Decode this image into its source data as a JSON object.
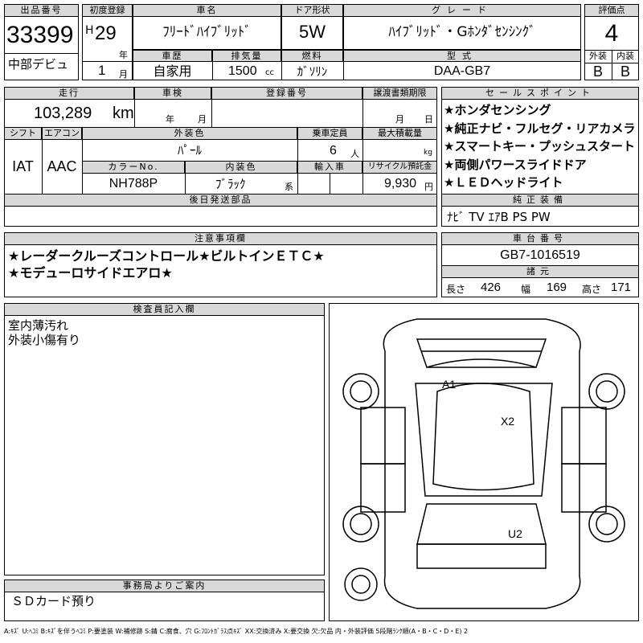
{
  "lot": {
    "label": "出品番号",
    "number": "33399",
    "venue": "中部デビュ"
  },
  "reg": {
    "label": "初度登録",
    "era": "H",
    "year": "29",
    "year_unit": "年",
    "month": "1",
    "month_unit": "月"
  },
  "car": {
    "label": "車名",
    "name": "ﾌﾘｰﾄﾞﾊｲﾌﾞﾘｯﾄﾞ"
  },
  "door": {
    "label": "ドア形状",
    "value": "5W"
  },
  "grade": {
    "label": "グレード",
    "value": "ﾊｲﾌﾞﾘｯﾄﾞ・Gﾎﾝﾀﾞｾﾝｼﾝｸﾞ"
  },
  "score": {
    "label": "評価点",
    "value": "4",
    "ext_label": "外装",
    "int_label": "内装",
    "ext": "B",
    "int": "B"
  },
  "history": {
    "label": "車歴",
    "value": "自家用"
  },
  "displacement": {
    "label": "排気量",
    "value": "1500",
    "unit": "cc"
  },
  "fuel": {
    "label": "燃料",
    "value": "ｶﾞｿﾘﾝ"
  },
  "model": {
    "label": "型式",
    "value": "DAA-GB7"
  },
  "mileage": {
    "label": "走行",
    "value": "103,289",
    "unit": "km"
  },
  "inspection": {
    "label": "車検",
    "year_unit": "年",
    "month_unit": "月"
  },
  "plate": {
    "label": "登録番号"
  },
  "transfer": {
    "label": "譲渡書類期限",
    "month_unit": "月",
    "day_unit": "日"
  },
  "shift": {
    "label": "シフト",
    "value": "IAT"
  },
  "aircon": {
    "label": "エアコン",
    "value": "AAC"
  },
  "exterior_color": {
    "label": "外装色",
    "value": "ﾊﾟｰﾙ"
  },
  "capacity": {
    "label": "乗車定員",
    "value": "6",
    "unit": "人"
  },
  "max_load": {
    "label": "最大積載量",
    "unit": "kg"
  },
  "color_no": {
    "label": "カラーNo.",
    "value": "NH788P"
  },
  "interior_color": {
    "label": "内装色",
    "value": "ﾌﾞﾗｯｸ",
    "suffix": "系"
  },
  "import": {
    "label": "輸入車"
  },
  "recycle": {
    "label": "リサイクル預託金",
    "value": "9,930",
    "unit": "円"
  },
  "later_parts": {
    "label": "後日発送部品"
  },
  "sales_points": {
    "label": "セールスポイント",
    "items": [
      "★ホンダセンシング",
      "★純正ナビ・フルセグ・リアカメラ",
      "★スマートキー・プッシュスタート",
      "★両側パワースライドドア",
      "★ＬＥＤヘッドライト"
    ]
  },
  "equipment": {
    "label": "純正装備",
    "value": "ﾅﾋﾞ TV ｴｱB PS PW"
  },
  "notes": {
    "label": "注意事項欄",
    "line1": "★レーダークルーズコントロール★ビルトインＥＴＣ★",
    "line2": "★モデューロサイドエアロ★"
  },
  "chassis": {
    "label": "車台番号",
    "value": "GB7-1016519"
  },
  "dims": {
    "label": "諸元",
    "length_label": "長さ",
    "length": "426",
    "width_label": "幅",
    "width": "169",
    "height_label": "高さ",
    "height": "171"
  },
  "inspector": {
    "label": "検査員記入欄",
    "line1": "室内薄汚れ",
    "line2": "外装小傷有り"
  },
  "diagram": {
    "marks": [
      "A1",
      "X2",
      "U2"
    ]
  },
  "office": {
    "label": "事務局よりご案内",
    "value": "ＳＤカード預り"
  },
  "legend": "A:ｷｽﾞ U:ﾍｺﾐ B:ｷｽﾞを伴うﾍｺﾐ P:要塗装 W:補修跡 S:錆 C:腐食、穴 G:ﾌﾛﾝﾄｶﾞﾗｽ点ｷｽﾞ XX:交換済み X:要交換 欠:欠品 内・外装評価 5段階ﾗﾝｸ順(A・B・C・D・E) 2"
}
